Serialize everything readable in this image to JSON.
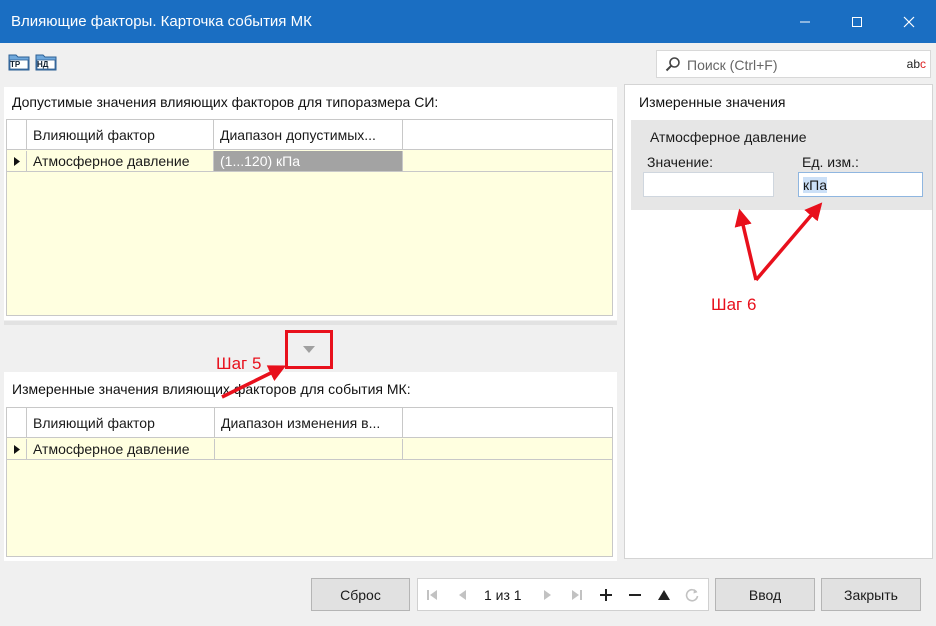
{
  "window": {
    "title": "Влияющие факторы. Карточка события МК",
    "minimize_icon": "minimize-icon",
    "maximize_icon": "maximize-icon",
    "close_icon": "close-icon"
  },
  "toolbar": {
    "btn_tr_label": "ТР",
    "btn_nd_label": "НД"
  },
  "search": {
    "placeholder": "Поиск (Ctrl+F)",
    "spell_abc": "ab",
    "spell_c": "c"
  },
  "allowed_panel": {
    "title": "Допустимые значения влияющих факторов для типоразмера СИ:",
    "columns": [
      "Влияющий фактор",
      "Диапазон допустимых..."
    ],
    "rows": [
      {
        "factor": "Атмосферное давление",
        "range": "(1...120) кПа"
      }
    ]
  },
  "measured_panel": {
    "title": "Измеренные значения влияющих факторов для события МК:",
    "columns": [
      "Влияющий фактор",
      "Диапазон изменения в..."
    ],
    "rows": [
      {
        "factor": "Атмосферное давление",
        "range": ""
      }
    ]
  },
  "right_panel": {
    "title": "Измеренные значения",
    "group_title": "Атмосферное давление",
    "value_label": "Значение:",
    "value": "",
    "unit_label": "Ед. изм.:",
    "unit_value": "кПа"
  },
  "annotations": {
    "step5": "Шаг 5",
    "step6": "Шаг 6",
    "accent_color": "#e8101c"
  },
  "bottom": {
    "reset_label": "Сброс",
    "page_indicator": "1 из 1",
    "enter_label": "Ввод",
    "close_label": "Закрыть"
  }
}
